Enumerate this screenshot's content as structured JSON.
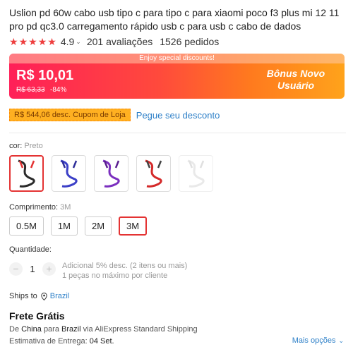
{
  "product": {
    "title": "Uslion pd 60w cabo usb tipo c para tipo c para xiaomi poco f3 plus mi 12 11 pro pd qc3.0 carregamento rápido usb c para usb c cabo de dados"
  },
  "rating": {
    "stars": 5,
    "score": "4.9",
    "reviews": "201 avaliações",
    "orders": "1526 pedidos"
  },
  "promo": {
    "banner_text": "Enjoy special discounts!",
    "price": "R$ 10,01",
    "old_price": "R$ 63,33",
    "discount": "-84%",
    "bonus_label": "Bônus Novo Usuário"
  },
  "coupon": {
    "tag": "R$ 544,06 desc. Cupom de Loja",
    "link": "Pegue seu desconto"
  },
  "color": {
    "label": "cor:",
    "selected": "Preto",
    "options": [
      {
        "name": "Preto",
        "color": "#2a2a2a"
      },
      {
        "name": "Azul",
        "color": "#3b3fc7"
      },
      {
        "name": "Roxo",
        "color": "#7b2fbf"
      },
      {
        "name": "Vermelho",
        "color": "#d42a2a"
      },
      {
        "name": "Branco",
        "color": "#e6e6e6"
      }
    ]
  },
  "length": {
    "label": "Comprimento:",
    "selected": "3M",
    "options": [
      "0.5M",
      "1M",
      "2M",
      "3M"
    ]
  },
  "quantity": {
    "label": "Quantidade:",
    "minus": "−",
    "value": "1",
    "plus": "+",
    "note_line1": "Adicional 5% desc. (2 itens ou mais)",
    "note_line2": "1 peças no máximo por cliente"
  },
  "shipping": {
    "ships_to_label": "Ships to",
    "country": "Brazil",
    "title": "Frete Grátis",
    "route_prefix": "De",
    "from": "China",
    "route_mid": "para",
    "to": "Brazil",
    "route_suffix": "via AliExpress Standard Shipping",
    "eta_label": "Estimativa de Entrega:",
    "eta_value": "04 Set.",
    "more_options": "Mais opções"
  },
  "theme": {
    "accent_red": "#e43333",
    "link_blue": "#2e80c8",
    "star_color": "#ee3d3d"
  }
}
